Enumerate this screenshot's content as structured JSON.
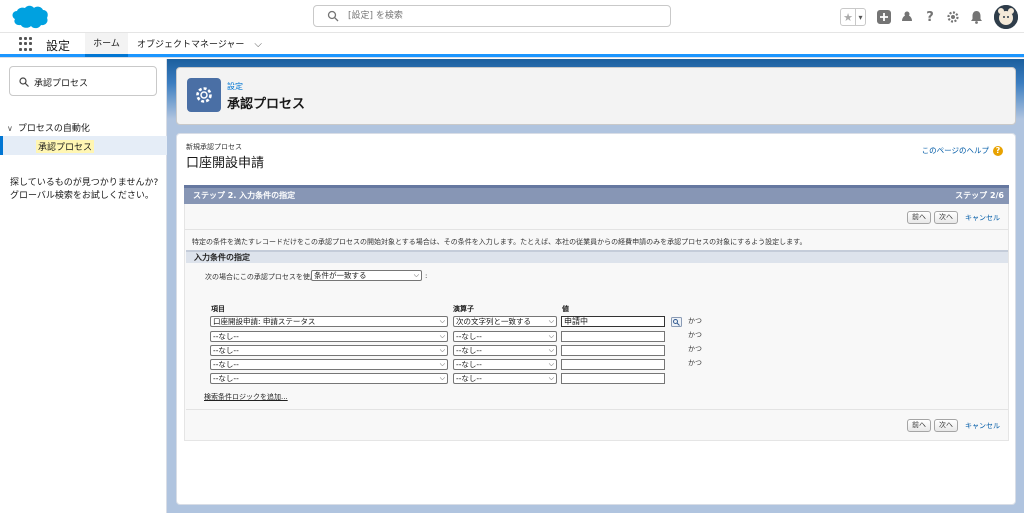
{
  "header": {
    "search_placeholder": "[設定] を検索",
    "icons": [
      "favorites-star-icon",
      "favorites-dropdown-icon",
      "global-actions-plus-icon",
      "trailhead-icon",
      "help-icon",
      "setup-gear-icon",
      "notifications-bell-icon",
      "user-avatar"
    ]
  },
  "nav": {
    "app_name": "設定",
    "tabs": [
      {
        "label": "ホーム",
        "active": true
      },
      {
        "label": "オブジェクトマネージャー",
        "has_dropdown": true
      }
    ]
  },
  "sidebar": {
    "quick_find_value": "承認プロセス",
    "tree_parent": "プロセスの自動化",
    "tree_child": "承認プロセス",
    "not_found_line1": "探しているものが見つかりませんか?",
    "not_found_line2": "グローバル検索をお試しください。"
  },
  "page_header": {
    "eyebrow": "設定",
    "title": "承認プロセス"
  },
  "main": {
    "eyebrow": "新規承認プロセス",
    "title": "口座開設申請",
    "help_link": "このページのヘルプ",
    "step_title": "ステップ 2. 入力条件の指定",
    "step_indicator": "ステップ 2/6",
    "buttons": {
      "prev": "前へ",
      "next": "次へ",
      "cancel": "キャンセル"
    },
    "description": "特定の条件を満たすレコードだけをこの承認プロセスの開始対象とする場合は、その条件を入力します。たとえば、本社の従業員からの経費申請のみを承認プロセスの対象にするよう設定します。",
    "section_title": "入力条件の指定",
    "use_label": "次の場合にこの承認プロセスを使用:",
    "use_value": "条件が一致する",
    "use_colon": ":",
    "columns": {
      "field": "項目",
      "operator": "演算子",
      "value": "値"
    },
    "rows": [
      {
        "field": "口座開設申請: 申請ステータス",
        "operator": "次の文字列と一致する",
        "value": "申請中",
        "conjunction": "かつ"
      },
      {
        "field": "--なし--",
        "operator": "--なし--",
        "value": "",
        "conjunction": "かつ"
      },
      {
        "field": "--なし--",
        "operator": "--なし--",
        "value": "",
        "conjunction": "かつ"
      },
      {
        "field": "--なし--",
        "operator": "--なし--",
        "value": "",
        "conjunction": "かつ"
      },
      {
        "field": "--なし--",
        "operator": "--なし--",
        "value": "",
        "conjunction": ""
      }
    ],
    "add_logic": "検索条件ロジックを追加..."
  },
  "colors": {
    "brand_blue": "#0176d3",
    "step_bar": "#8796b5",
    "background": "#b0c4df",
    "highlight": "#fff6b3"
  }
}
